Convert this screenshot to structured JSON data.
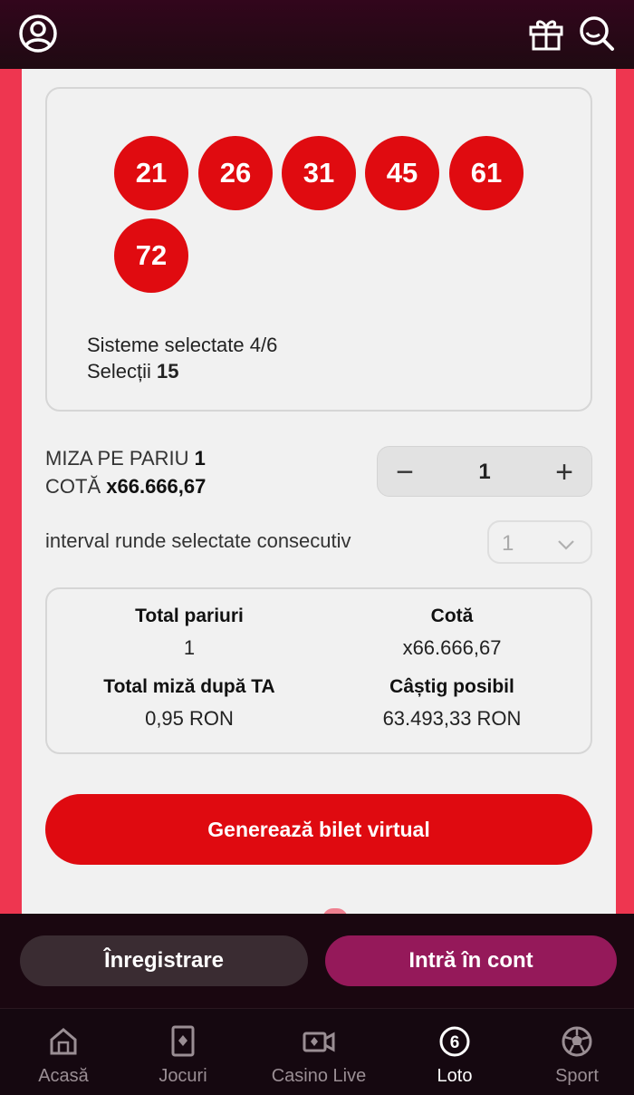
{
  "header": {
    "icons": [
      "user-icon",
      "gift-icon",
      "search-icon"
    ]
  },
  "selection": {
    "numbers": [
      "21",
      "26",
      "31",
      "45",
      "61",
      "72"
    ],
    "systems_label": "Sisteme selectate 4/6",
    "selections_label": "Selecții",
    "selections_value": "15"
  },
  "stake": {
    "label": "MIZA PE PARIU",
    "value": "1",
    "odds_label": "COTĂ",
    "odds_value": "x66.666,67",
    "stepper_value": "1",
    "minus": "−",
    "plus": "+"
  },
  "interval": {
    "label": "interval runde selectate consecutiv",
    "selected": "1"
  },
  "summary": {
    "total_bets_label": "Total pariuri",
    "total_bets_value": "1",
    "odds_label": "Cotă",
    "odds_value": "x66.666,67",
    "total_stake_label": "Total miză după TA",
    "total_stake_value": "0,95 RON",
    "possible_win_label": "Câștig posibil",
    "possible_win_value": "63.493,33 RON"
  },
  "generate_button": "Generează bilet virtual",
  "auth": {
    "register": "Înregistrare",
    "login": "Intră în cont"
  },
  "nav": [
    {
      "label": "Acasă",
      "icon": "home-icon",
      "active": false
    },
    {
      "label": "Jocuri",
      "icon": "cards-icon",
      "active": false
    },
    {
      "label": "Casino Live",
      "icon": "live-camera-icon",
      "active": false
    },
    {
      "label": "Loto",
      "icon": "loto-ball-icon",
      "active": true,
      "badge": "6"
    },
    {
      "label": "Sport",
      "icon": "football-icon",
      "active": false
    }
  ],
  "colors": {
    "accent_red": "#df0a10",
    "side_red": "#ee3650",
    "login_magenta": "#95195a",
    "dark_bg": "#1a0710"
  }
}
